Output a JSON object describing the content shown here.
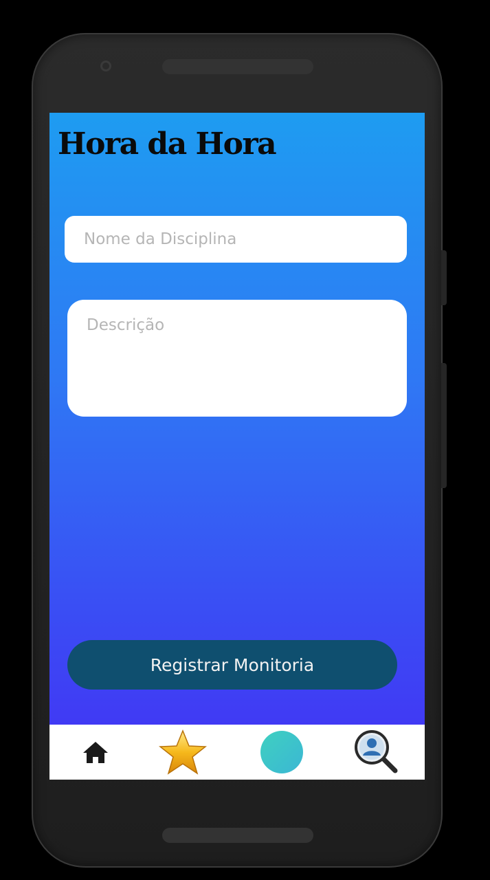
{
  "app": {
    "title": "Hora da Hora"
  },
  "form": {
    "discipline_placeholder": "Nome da Disciplina",
    "discipline_value": "",
    "description_placeholder": "Descrição",
    "description_value": "",
    "submit_label": "Registrar Monitoria"
  },
  "bottom_nav": {
    "items": [
      {
        "icon": "home-icon"
      },
      {
        "icon": "star-icon"
      },
      {
        "icon": "teal-circle-icon"
      },
      {
        "icon": "profile-search-icon"
      }
    ]
  },
  "colors": {
    "gradient_top": "#1e9cf1",
    "gradient_bottom": "#4431f4",
    "button_bg": "#0f4f6f",
    "accent_teal": "#3fd0c0"
  }
}
